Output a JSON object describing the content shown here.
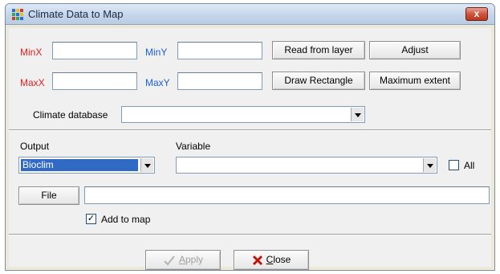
{
  "window": {
    "title": "Climate Data to Map",
    "close_glyph": "x"
  },
  "extent": {
    "minx_label": "MinX",
    "miny_label": "MinY",
    "maxx_label": "MaxX",
    "maxy_label": "MaxY",
    "minx_value": "",
    "miny_value": "",
    "maxx_value": "",
    "maxy_value": "",
    "read_from_layer_label": "Read from layer",
    "adjust_label": "Adjust",
    "draw_rectangle_label": "Draw Rectangle",
    "maximum_extent_label": "Maximum extent",
    "min_color": "#e02020",
    "max_color": "#1a5fd6"
  },
  "database": {
    "label": "Climate database",
    "selected": ""
  },
  "output": {
    "output_label": "Output",
    "output_selected": "Bioclim",
    "variable_label": "Variable",
    "variable_selected": "",
    "all_label": "All",
    "all_checked": false,
    "file_button_label": "File",
    "file_path": "",
    "add_to_map_label": "Add to map",
    "add_to_map_checked": true
  },
  "actions": {
    "apply_label_prefix": "",
    "apply_label_underlined": "A",
    "apply_label_rest": "pply",
    "close_label_underlined": "C",
    "close_label_rest": "lose"
  },
  "icons": {
    "app": "app-grid-icon",
    "apply": "checkmark-icon",
    "close": "red-x-icon"
  }
}
